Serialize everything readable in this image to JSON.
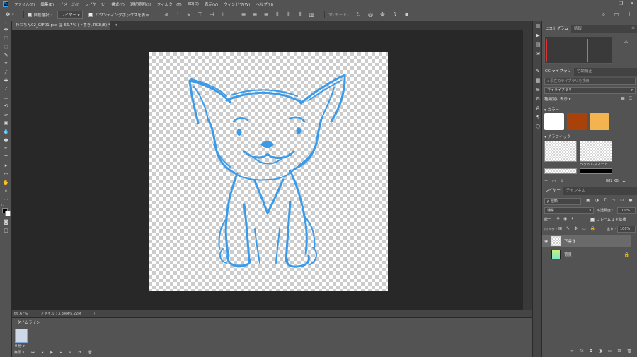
{
  "menubar": {
    "logo": "Ps",
    "items": [
      "ファイル(F)",
      "編集(E)",
      "イメージ(I)",
      "レイヤー(L)",
      "書式(Y)",
      "選択範囲(S)",
      "フィルター(T)",
      "3D(D)",
      "表示(V)",
      "ウィンドウ(W)",
      "ヘルプ(H)"
    ],
    "window_controls": [
      "—",
      "❐",
      "✕"
    ]
  },
  "options": {
    "auto_select_label": "自動選択 :",
    "auto_select_target": "レイヤー",
    "bounding_box_label": "バウンディングボックスを表示",
    "mode_3d": "3D モード :"
  },
  "document": {
    "tab_title": "わわちん02_GIF01.psd @ 66.7% (下書き, RGB/8) *",
    "close_glyph": "×"
  },
  "status": {
    "zoom": "66.67%",
    "file_info": "ファイル : 3.34M/5.22M",
    "arrow": "›"
  },
  "timeline": {
    "tab_label": "タイムライン",
    "frame_time": "0 秒 ▾",
    "loop_label": "無限"
  },
  "panels": {
    "top_tabs": [
      "ヒストグラム",
      "情報"
    ],
    "warning": "⚠",
    "cc_tabs": [
      "CC ライブラリ",
      "色調補正"
    ],
    "search_placeholder": "現在のライブラリを検索",
    "library_name": "マイライブラリ",
    "view_by": "種類別に表示 ▾",
    "colors_header": "▾ カラー",
    "swatch_colors": [
      "#ffffff",
      "#a8420a",
      "#f5b350"
    ],
    "graphics_header": "▾ グラフィック",
    "graphic_label": "ベクトルスマート...",
    "storage": "882 KB",
    "layers_tabs": [
      "レイヤー",
      "チャンネル"
    ],
    "kind_label": "ρ 種類",
    "blend_mode": "通常",
    "opacity_label": "不透明度 :",
    "opacity_value": "100%",
    "unify_label": "統一 :",
    "frame_label": "フレーム 1 を伝播",
    "lock_label": "ロック :",
    "fill_label": "塗り :",
    "fill_value": "100%",
    "layers": [
      {
        "name": "下書き",
        "visible": true
      },
      {
        "name": "背景",
        "visible": false
      }
    ],
    "bottom_icons": [
      "∞",
      "fx",
      "◘",
      "◑",
      "▭",
      "⊞",
      "🗑"
    ]
  }
}
